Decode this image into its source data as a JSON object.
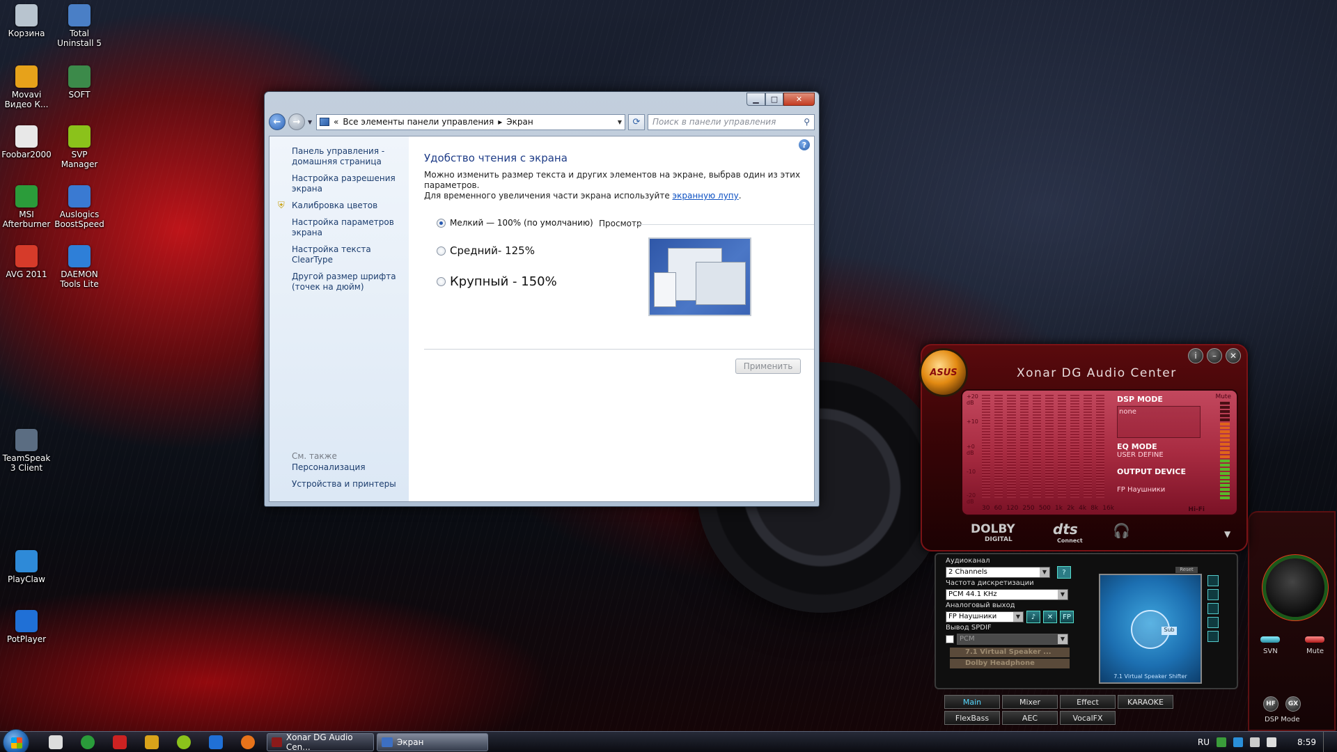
{
  "desktop": {
    "icons": [
      {
        "label": "Корзина",
        "icon": "recycle-bin-icon",
        "color": "#b8c4cf"
      },
      {
        "label": "Total Uninstall 5",
        "icon": "total-uninstall-icon",
        "color": "#4a7fc6"
      },
      {
        "label": "Movavi Видео К...",
        "icon": "movavi-icon",
        "color": "#e7a21a"
      },
      {
        "label": "SOFT",
        "icon": "folder-icon",
        "color": "#3c8a4a"
      },
      {
        "label": "Foobar2000",
        "icon": "foobar-icon",
        "color": "#e8e8e8"
      },
      {
        "label": "SVP Manager",
        "icon": "svp-icon",
        "color": "#8bc21b"
      },
      {
        "label": "MSI Afterburner",
        "icon": "msi-afterburner-icon",
        "color": "#2b9c3a"
      },
      {
        "label": "Auslogics BoostSpeed",
        "icon": "auslogics-icon",
        "color": "#3a7ad2"
      },
      {
        "label": "AVG 2011",
        "icon": "avg-icon",
        "color": "#d63b2a"
      },
      {
        "label": "DAEMON Tools Lite",
        "icon": "daemon-tools-icon",
        "color": "#2e7fd8"
      },
      {
        "label": "TeamSpeak 3 Client",
        "icon": "teamspeak-icon",
        "color": "#5b6d82"
      },
      {
        "label": "PlayClaw",
        "icon": "playclaw-icon",
        "color": "#2e8ad8"
      },
      {
        "label": "PotPlayer",
        "icon": "potplayer-icon",
        "color": "#2070d6"
      }
    ]
  },
  "explorer": {
    "address": {
      "prefix": "«",
      "crumb1": "Все элементы панели управления",
      "separator": "▸",
      "crumb2": "Экран"
    },
    "search_placeholder": "Поиск в панели управления",
    "sidebar": {
      "links": [
        "Панель управления - домашняя страница",
        "Настройка разрешения экрана",
        "Калибровка цветов",
        "Настройка параметров экрана",
        "Настройка текста ClearType",
        "Другой размер шрифта (точек на дюйм)"
      ],
      "see_also": "См. также",
      "bottom_links": [
        "Персонализация",
        "Устройства и принтеры"
      ]
    },
    "main": {
      "title": "Удобство чтения с экрана",
      "desc_line1": "Можно изменить размер текста и других элементов на экране, выбрав один из этих параметров.",
      "desc_line2": "Для временного увеличения части экрана используйте ",
      "desc_link": "экранную лупу",
      "desc_end": ".",
      "options": [
        {
          "label": "Мелкий — 100% (по умолчанию)",
          "selected": true
        },
        {
          "label": "Средний- 125%",
          "selected": false
        },
        {
          "label": "Крупный - 150%",
          "selected": false
        }
      ],
      "preview_label": "Просмотр",
      "apply_label": "Применить"
    }
  },
  "xonar": {
    "logo": "ASUS",
    "title": "Xonar DG Audio Center",
    "eq_scale": [
      "+20 dB",
      "+10",
      "+0 dB",
      "-10",
      "-20 dB"
    ],
    "eq_freqs": [
      "30",
      "60",
      "120",
      "250",
      "500",
      "1k",
      "2k",
      "4k",
      "8k",
      "16k"
    ],
    "dsp_mode_label": "DSP MODE",
    "dsp_mode_value": "none",
    "eq_mode_label": "EQ MODE",
    "eq_mode_value": "USER DEFINE",
    "output_device_label": "OUTPUT DEVICE",
    "output_device_value": "FP Наушники",
    "mute_label": "Mute",
    "hifi_label": "Hi-Fi",
    "brand_logos": {
      "dolby": "DOLBY",
      "dolby_sub": "DIGITAL",
      "dts": "dts",
      "dts_sub": "Connect"
    },
    "panel": {
      "channel_label": "Аудиоканал",
      "channel_value": "2 Channels",
      "rate_label": "Частота дискретизации",
      "rate_value": "PCM 44.1 KHz",
      "analog_label": "Аналоговый выход",
      "analog_value": "FP Наушники",
      "spdif_label": "Вывод SPDIF",
      "spdif_value": "PCM",
      "virtual_speaker": "7.1 Virtual Speaker ...",
      "dolby_headphone": "Dolby Headphone",
      "reset_label": "Reset",
      "speaker_shifter": "7.1 Virtual Speaker Shifter",
      "sub_label": "Sub"
    },
    "tabs": [
      "Main",
      "Mixer",
      "Effect",
      "KARAOKE",
      "FlexBass",
      "AEC",
      "VocalFX"
    ],
    "active_tab": "Main",
    "right": {
      "svn": "SVN",
      "mute": "Mute",
      "hf": "HF",
      "gx": "GX",
      "dsp_mode": "DSP Mode"
    }
  },
  "taskbar": {
    "tasks": [
      {
        "label": "Xonar DG Audio Cen...",
        "icon_color": "#8a1a1a"
      },
      {
        "label": "Экран",
        "icon_color": "#3d6fc2"
      }
    ],
    "lang": "RU",
    "time": "8:59"
  }
}
